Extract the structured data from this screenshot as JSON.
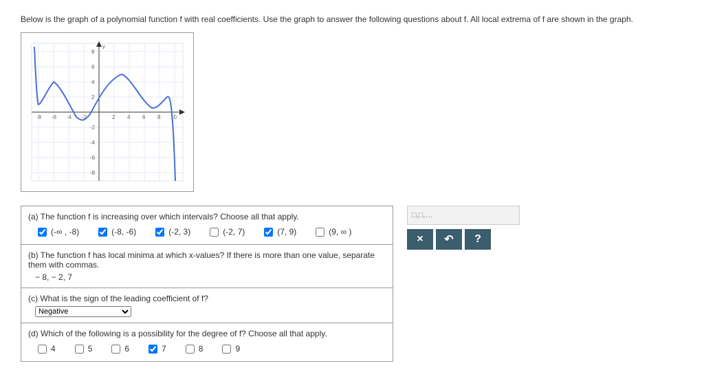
{
  "intro": "Below is the graph of a polynomial function f with real coefficients. Use the graph to answer the following questions about f. All local extrema of f are shown in the graph.",
  "parts": {
    "a": {
      "q": "(a) The function f is increasing over which intervals? Choose all that apply.",
      "opts": [
        {
          "label": "(-∞ , -8)",
          "checked": true
        },
        {
          "label": "(-8, -6)",
          "checked": true
        },
        {
          "label": "(-2, 3)",
          "checked": true
        },
        {
          "label": "(-2, 7)",
          "checked": false
        },
        {
          "label": "(7, 9)",
          "checked": true
        },
        {
          "label": "(9, ∞ )",
          "checked": false
        }
      ]
    },
    "b": {
      "q": "(b) The function f has local minima at which x-values? If there is more than one value, separate them with commas.",
      "ans": "− 8, − 2, 7"
    },
    "c": {
      "q": "(c) What is the sign of the leading coefficient of f?",
      "sel": "Negative"
    },
    "d": {
      "q": "(d) Which of the following is a possibility for the degree of f? Choose all that apply.",
      "opts": [
        {
          "label": "4",
          "checked": false
        },
        {
          "label": "5",
          "checked": false
        },
        {
          "label": "6",
          "checked": false
        },
        {
          "label": "7",
          "checked": true
        },
        {
          "label": "8",
          "checked": false
        },
        {
          "label": "9",
          "checked": false
        }
      ]
    }
  },
  "side": {
    "hint": "□,□,…",
    "btns": {
      "close": "×",
      "undo": "↶",
      "help": "?"
    }
  },
  "chart_data": {
    "type": "line",
    "title": "",
    "xlabel": "",
    "ylabel": "y",
    "xlim": [
      -8,
      10
    ],
    "ylim": [
      -8,
      8
    ],
    "xticks": [
      -8,
      -6,
      -4,
      -2,
      2,
      4,
      6,
      8,
      10
    ],
    "yticks": [
      -8,
      -6,
      -4,
      -2,
      2,
      4,
      6,
      8
    ],
    "series": [
      {
        "name": "f",
        "x": [
          -8.5,
          -8,
          -7,
          -6,
          -5,
          -4,
          -3,
          -2,
          -1,
          0,
          1,
          2,
          3,
          4,
          5,
          6,
          7,
          8,
          9,
          9.5
        ],
        "y": [
          8,
          1,
          2.5,
          4,
          3,
          1,
          -0.5,
          -1,
          0,
          1.5,
          3.2,
          4.5,
          5,
          4.2,
          2.5,
          1,
          0.5,
          1,
          2,
          -8
        ]
      }
    ],
    "extrema": {
      "local_min_x": [
        -8,
        -2,
        7
      ],
      "local_max_x": [
        -6,
        3,
        9
      ]
    }
  }
}
